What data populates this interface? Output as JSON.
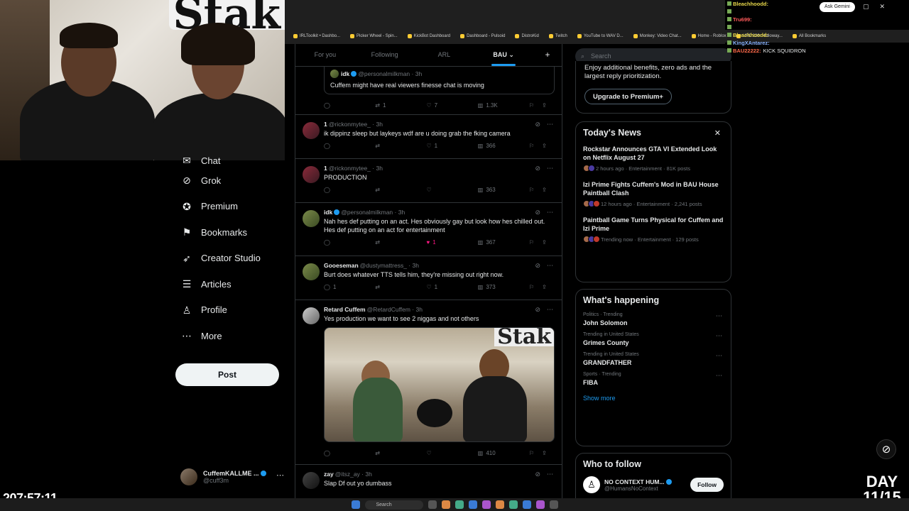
{
  "webcam": {
    "brand": "Stak"
  },
  "browser": {
    "ask_gemini": "Ask Gemini",
    "bookmarks": [
      "IRLToolkit • Dashbo...",
      "Picker Wheel - Spin...",
      "KickBot Dashboard",
      "Dashboard - Pulsoid",
      "DistroKid",
      "Twitch",
      "YouTube to WAV D...",
      "Monkey: Video Chat...",
      "Home - Roblox",
      "UFC 326: Holloway...",
      "All Bookmarks"
    ]
  },
  "nav": {
    "items": [
      {
        "label": "Chat",
        "icon": "chat-icon"
      },
      {
        "label": "Grok",
        "icon": "grok-icon"
      },
      {
        "label": "Premium",
        "icon": "premium-icon"
      },
      {
        "label": "Bookmarks",
        "icon": "bookmark-icon"
      },
      {
        "label": "Creator Studio",
        "icon": "rocket-icon"
      },
      {
        "label": "Articles",
        "icon": "articles-icon"
      },
      {
        "label": "Profile",
        "icon": "profile-icon"
      },
      {
        "label": "More",
        "icon": "more-icon"
      }
    ],
    "post_label": "Post",
    "account_name": "CuffemKALLME ...",
    "account_handle": "@cuff3m"
  },
  "tabs": [
    "For you",
    "Following",
    "ARL",
    "BAU ⌄",
    "+"
  ],
  "tweets": [
    {
      "quote_name": "idk",
      "quote_handle": "@personalmilkman · 3h",
      "quote_text": "Cuffem might have real viewers finesse chat is moving",
      "reply": "",
      "retweet": "1",
      "like": "7",
      "views": "1.3K"
    },
    {
      "name": "1",
      "handle": "@rickonmytee_ · 3h",
      "text": "ik dippinz sleep but laykeys wdf are u doing grab the fking camera",
      "reply": "",
      "retweet": "",
      "like": "1",
      "views": "366"
    },
    {
      "name": "1",
      "handle": "@rickonmytee_ · 3h",
      "text": "PRODUCTION",
      "reply": "",
      "retweet": "",
      "like": "",
      "views": "363"
    },
    {
      "name": "idk",
      "handle": "@personalmilkman · 3h",
      "text": "Nah hes def putting on an act. Hes obviously gay but look how hes chilled out. Hes def putting on an act for entertainment",
      "reply": "",
      "retweet": "",
      "like": "1",
      "views": "367"
    },
    {
      "name": "Gooeseman",
      "handle": "@dustymattress_ · 3h",
      "text": "Burt does whatever TTS tells him, they're missing out right now.",
      "reply": "1",
      "retweet": "",
      "like": "1",
      "views": "373"
    },
    {
      "name": "Retard Cuffem",
      "handle": "@RetardCuffem · 3h",
      "text": "Yes production we want to see 2 niggas and not others",
      "media_brand": "Stak",
      "reply": "",
      "retweet": "",
      "like": "",
      "views": "410"
    },
    {
      "name": "zay",
      "handle": "@itsz_ay · 3h",
      "text": "Slap Df out yo dumbass"
    }
  ],
  "right": {
    "search_placeholder": "Search",
    "premium_text": "Enjoy additional benefits, zero ads and the largest reply prioritization.",
    "premium_btn": "Upgrade to Premium+",
    "news_title": "Today's News",
    "news": [
      {
        "headline": "Rockstar Announces GTA VI Extended Look on Netflix August 27",
        "meta": "2 hours ago · Entertainment · 81K posts"
      },
      {
        "headline": "Izi Prime Fights Cuffem's Mod in BAU House Paintball Clash",
        "meta": "12 hours ago · Entertainment · 2,241 posts"
      },
      {
        "headline": "Paintball Game Turns Physical for Cuffem and Izi Prime",
        "meta": "Trending now · Entertainment · 129 posts"
      }
    ],
    "happening_title": "What's happening",
    "trends": [
      {
        "context": "Politics · Trending",
        "name": "John Solomon"
      },
      {
        "context": "Trending in United States",
        "name": "Grimes County"
      },
      {
        "context": "Trending in United States",
        "name": "GRANDFATHER"
      },
      {
        "context": "Sports · Trending",
        "name": "FIBA"
      }
    ],
    "show_more": "Show more",
    "follow_title": "Who to follow",
    "follow_name": "NO CONTEXT HUM...",
    "follow_handle": "@HumansNoContext",
    "follow_btn": "Follow"
  },
  "chat": [
    {
      "user": "Bleachhoodd:",
      "msg": "",
      "color": "#e8d84a"
    },
    {
      "user": "",
      "msg": "",
      "color": "#ff4444"
    },
    {
      "user": "Tru699:",
      "msg": "",
      "color": "#ff5a5a"
    },
    {
      "user": "",
      "msg": "",
      "color": "#ff5a5a"
    },
    {
      "user": "Bleachhoodd:",
      "msg": "",
      "color": "#e8d84a"
    },
    {
      "user": "KingXAntarez:",
      "msg": "",
      "color": "#8ab4ff"
    },
    {
      "user": "BAU22222:",
      "msg": "KICK SQUIDRON",
      "color": "#ff6a4a"
    }
  ],
  "overlay": {
    "timer": "207:57:11",
    "day_line1": "DAY",
    "day_line2": "11/15"
  },
  "taskbar": {
    "search": "Search"
  }
}
